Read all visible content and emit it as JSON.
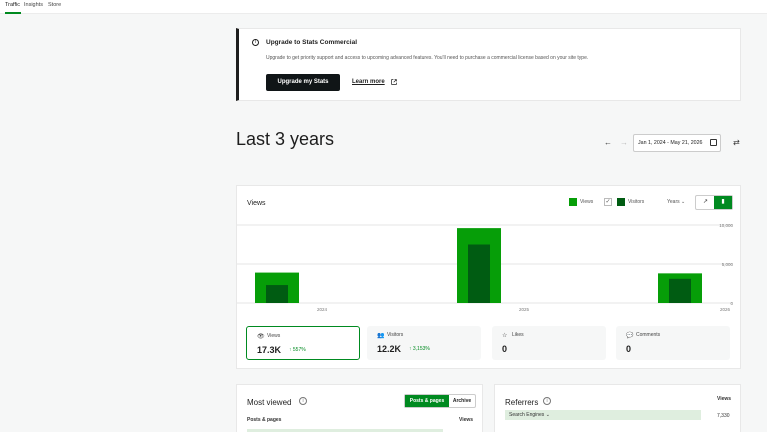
{
  "tabs": [
    {
      "label": "Traffic",
      "active": true
    },
    {
      "label": "Insights",
      "active": false
    },
    {
      "label": "Store",
      "active": false
    }
  ],
  "notice": {
    "title": "Upgrade to Stats Commercial",
    "description": "Upgrade to get priority support and access to upcoming advanced features. You'll need to purchase a commercial license based on your site type.",
    "upgrade_button": "Upgrade my Stats",
    "learn_more": "Learn more",
    "info_icon": "info-icon",
    "external_icon": "external-link-icon"
  },
  "header": {
    "title": "Last 3 years",
    "date_range": "Jan 1, 2024 - May 21, 2026",
    "prev_icon": "←",
    "next_icon": "→",
    "filter_icon": "⇄"
  },
  "chart_card": {
    "title": "Views",
    "legend_views": "Views",
    "legend_visitors": "Visitors",
    "period": "Years",
    "chart_type_line_icon": "↗",
    "chart_type_bar_icon": "▮"
  },
  "chart_data": {
    "type": "bar",
    "categories": [
      "2024",
      "2025",
      "2026"
    ],
    "series": [
      {
        "name": "Views",
        "values": [
          3900,
          9600,
          3800
        ],
        "color": "#069e08"
      },
      {
        "name": "Visitors",
        "values": [
          2300,
          7500,
          3100
        ],
        "color": "#005c12"
      }
    ],
    "ylim": [
      0,
      10000
    ],
    "yticks": [
      "10,000",
      "5,000",
      "0"
    ],
    "grid": true
  },
  "stats": [
    {
      "icon": "👁",
      "label": "Views",
      "value": "17.3K",
      "change": "↑ 557%",
      "active": true
    },
    {
      "icon": "👥",
      "label": "Visitors",
      "value": "12.2K",
      "change": "↑ 3,153%",
      "active": false
    },
    {
      "icon": "☆",
      "label": "Likes",
      "value": "0",
      "change": "",
      "active": false
    },
    {
      "icon": "💬",
      "label": "Comments",
      "value": "0",
      "change": "",
      "active": false
    }
  ],
  "most_viewed": {
    "title": "Most viewed",
    "tab_posts": "Posts & pages",
    "tab_archive": "Archive",
    "col_left": "Posts & pages",
    "col_right": "Views"
  },
  "referrers": {
    "title": "Referrers",
    "col_right": "Views",
    "row_label": "Search Engines",
    "row_value": "7,330"
  },
  "colors": {
    "accent": "#008a20",
    "views": "#069e08",
    "visitors": "#005c12"
  }
}
